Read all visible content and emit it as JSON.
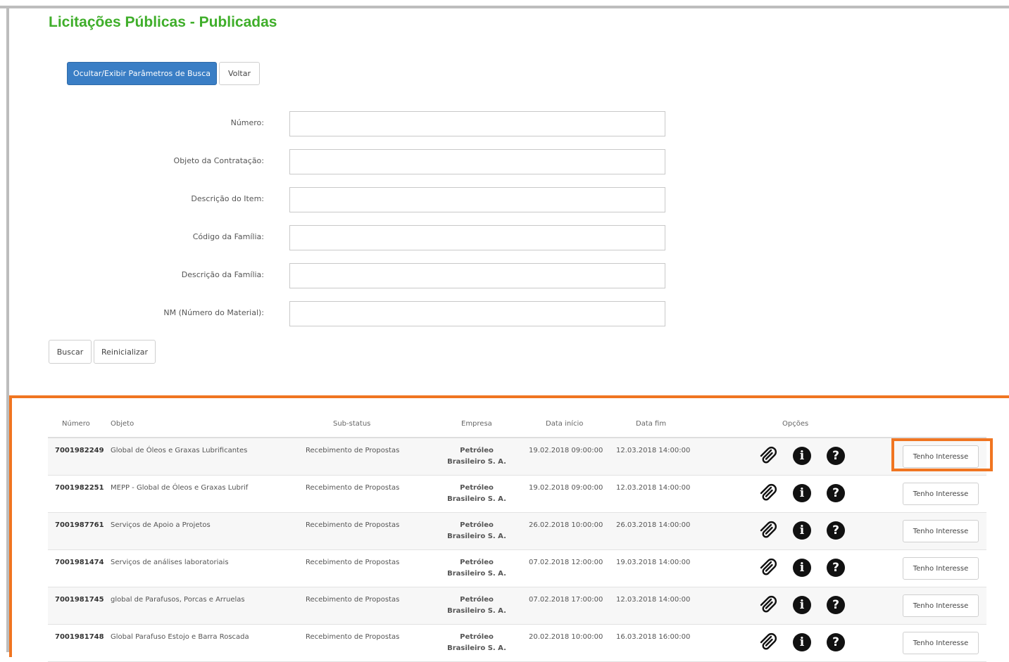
{
  "page": {
    "title": "Licitações Públicas - Publicadas"
  },
  "toolbar": {
    "toggle_label": "Ocultar/Exibir Parâmetros de Busca",
    "back_label": "Voltar"
  },
  "form": {
    "fields": [
      {
        "label": "Número:",
        "value": ""
      },
      {
        "label": "Objeto da Contratação:",
        "value": ""
      },
      {
        "label": "Descrição do Item:",
        "value": ""
      },
      {
        "label": "Código da Família:",
        "value": ""
      },
      {
        "label": "Descrição da Família:",
        "value": ""
      },
      {
        "label": "NM (Número do Material):",
        "value": ""
      }
    ],
    "search_label": "Buscar",
    "reset_label": "Reinicializar"
  },
  "table": {
    "headers": {
      "numero": "Número",
      "objeto": "Objeto",
      "substatus": "Sub-status",
      "empresa": "Empresa",
      "data_inicio": "Data início",
      "data_fim": "Data fim",
      "opcoes": "Opções"
    },
    "action_label": "Tenho Interesse",
    "icons": [
      "paperclip-icon",
      "info-icon",
      "help-icon"
    ],
    "rows": [
      {
        "numero": "7001982249",
        "objeto": "Global de Óleos e Graxas Lubrificantes",
        "substatus": "Recebimento de Propostas",
        "empresa": "Petróleo Brasileiro S. A.",
        "data_inicio": "19.02.2018 09:00:00",
        "data_fim": "12.03.2018 14:00:00"
      },
      {
        "numero": "7001982251",
        "objeto": "MEPP - Global de Óleos e Graxas Lubrif",
        "substatus": "Recebimento de Propostas",
        "empresa": "Petróleo Brasileiro S. A.",
        "data_inicio": "19.02.2018 09:00:00",
        "data_fim": "12.03.2018 14:00:00"
      },
      {
        "numero": "7001987761",
        "objeto": "Serviços de Apoio a Projetos",
        "substatus": "Recebimento de Propostas",
        "empresa": "Petróleo Brasileiro S. A.",
        "data_inicio": "26.02.2018 10:00:00",
        "data_fim": "26.03.2018 14:00:00"
      },
      {
        "numero": "7001981474",
        "objeto": "Serviços de análises laboratoriais",
        "substatus": "Recebimento de Propostas",
        "empresa": "Petróleo Brasileiro S. A.",
        "data_inicio": "07.02.2018 12:00:00",
        "data_fim": "19.03.2018 14:00:00"
      },
      {
        "numero": "7001981745",
        "objeto": "global de Parafusos, Porcas e Arruelas",
        "substatus": "Recebimento de Propostas",
        "empresa": "Petróleo Brasileiro S. A.",
        "data_inicio": "07.02.2018 17:00:00",
        "data_fim": "12.03.2018 14:00:00"
      },
      {
        "numero": "7001981748",
        "objeto": "Global Parafuso Estojo e Barra Roscada",
        "substatus": "Recebimento de Propostas",
        "empresa": "Petróleo Brasileiro S. A.",
        "data_inicio": "20.02.2018 10:00:00",
        "data_fim": "16.03.2018 16:00:00"
      }
    ]
  },
  "colors": {
    "title": "#3fae2a",
    "primary": "#3a7ec5",
    "highlight": "#f07521"
  }
}
